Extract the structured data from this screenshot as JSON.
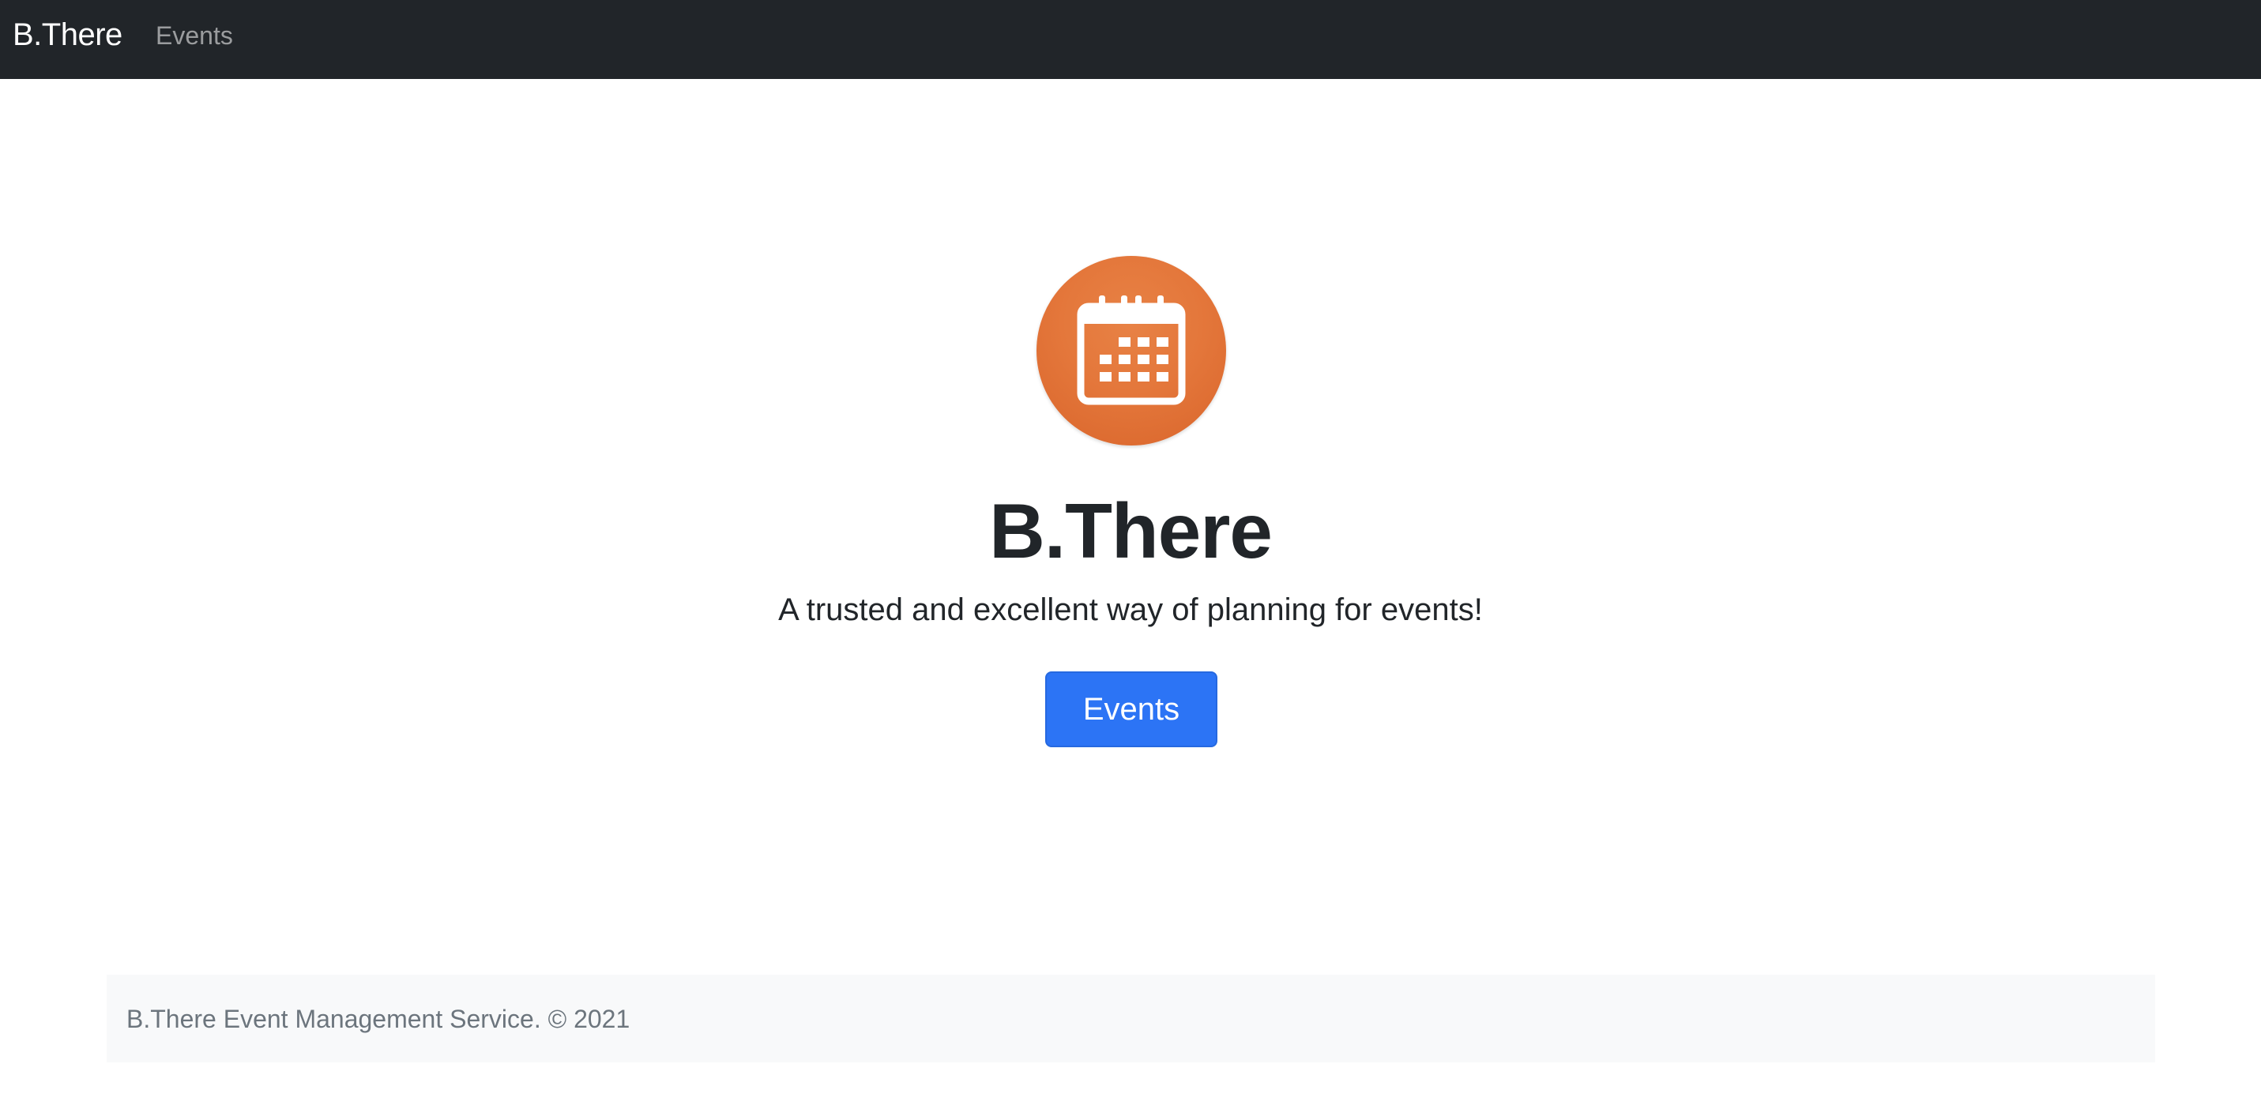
{
  "navbar": {
    "brand": "B.There",
    "links": [
      {
        "label": "Events"
      }
    ],
    "background": "#212529"
  },
  "hero": {
    "logo_icon": "calendar-icon",
    "logo_color": "#e4773b",
    "title": "B.There",
    "lead": "A trusted and excellent way of planning for events!",
    "button_label": "Events",
    "button_color": "#2c74f5"
  },
  "footer": {
    "text": "B.There Event Management Service. © 2021"
  }
}
